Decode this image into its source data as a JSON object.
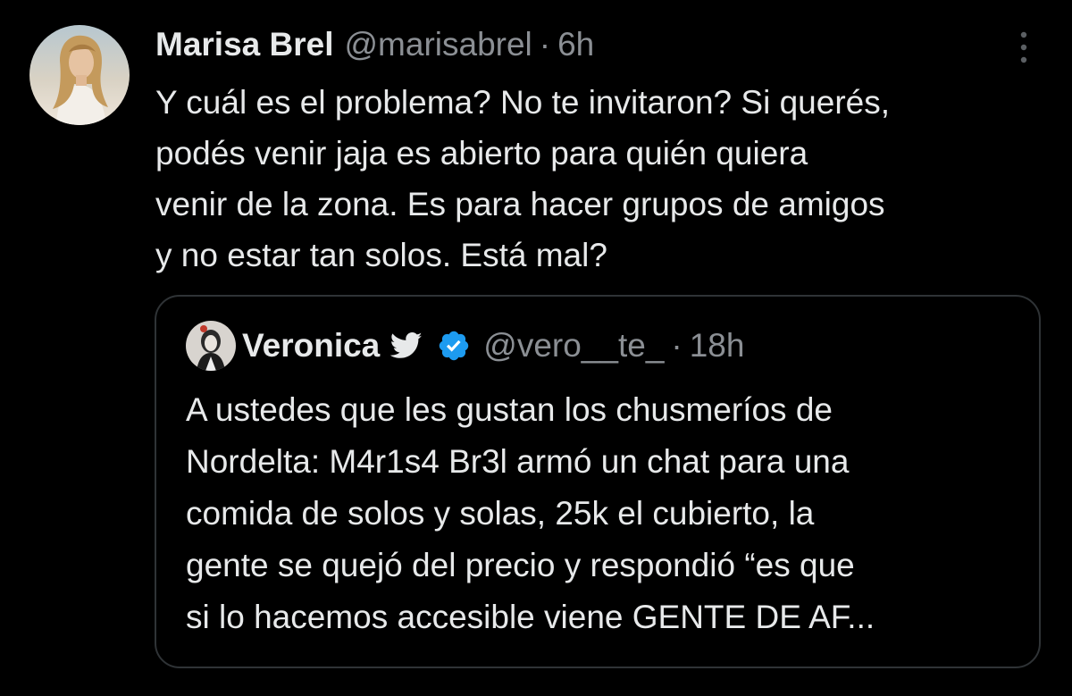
{
  "tweet": {
    "author_name": "Marisa Brel",
    "author_handle": "@marisabrel",
    "separator": "·",
    "time": "6h",
    "text": "Y cuál es el problema? No te invitaron? Si querés,\npodés venir jaja es abierto para quién quiera\nvenir de la zona. Es para hacer grupos de amigos\ny no estar tan solos. Está mal?",
    "more_icon": "more-vertical-icon"
  },
  "quoted_tweet": {
    "author_name": "Veronica",
    "badge_icon": "twitter-bird-icon",
    "verified_icon": "verified-badge-icon",
    "author_handle": "@vero__te_",
    "separator": "·",
    "time": "18h",
    "text": "A ustedes que les gustan los chusmeríos de\nNordelta: M4r1s4 Br3l armó un chat para una\ncomida de solos y solas, 25k el cubierto, la\ngente se quejó del precio y respondió “es que\nsi lo hacemos accesible viene GENTE DE AF..."
  },
  "colors": {
    "background": "#000000",
    "text_primary": "#e7e9ea",
    "text_secondary": "#8b8f94",
    "border": "#2f3336",
    "verified_blue": "#1d9bf0"
  }
}
